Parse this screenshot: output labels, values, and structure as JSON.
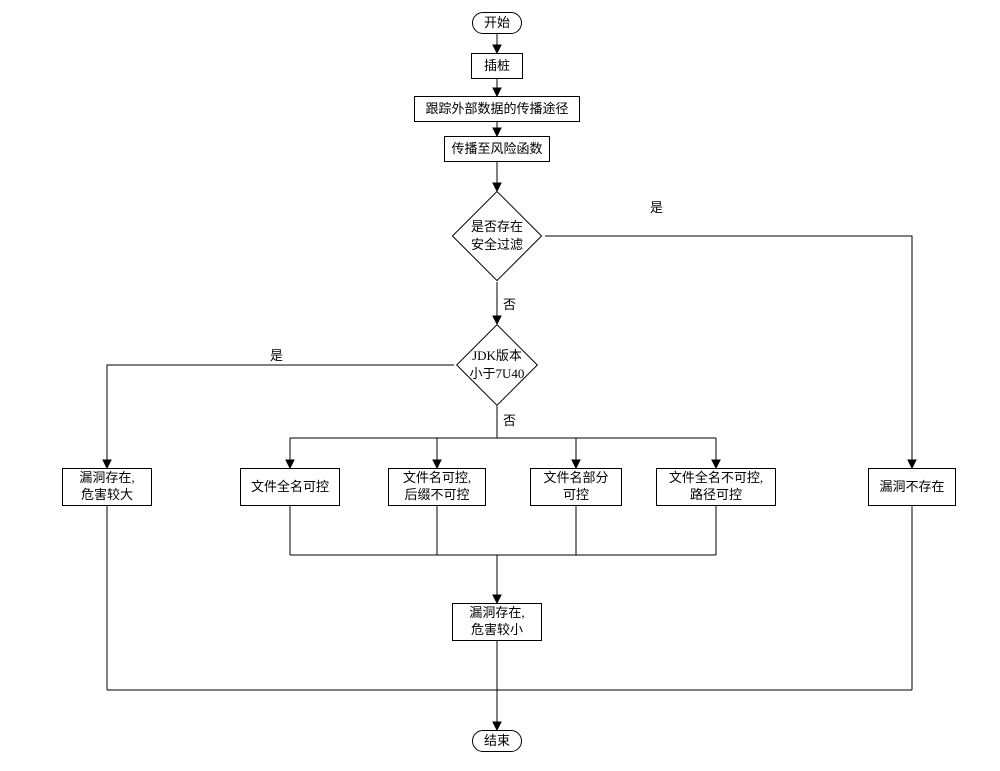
{
  "nodes": {
    "start": "开始",
    "instrument": "插桩",
    "track": "跟踪外部数据的传播途径",
    "propagate": "传播至风险函数",
    "decision_filter": "是否存在\n安全过滤",
    "decision_jdk": "JDK版本\n小于7U40",
    "vuln_big": "漏洞存在,\n危害较大",
    "name_full_ctl": "文件全名可控",
    "name_ctl_suffix_not": "文件名可控,\n后缀不可控",
    "name_partial_ctl": "文件名部分\n可控",
    "name_not_ctl_path_ctl": "文件全名不可控,\n路径可控",
    "vuln_none": "漏洞不存在",
    "vuln_small": "漏洞存在,\n危害较小",
    "end": "结束"
  },
  "edge_labels": {
    "yes1": "是",
    "no1": "否",
    "yes2": "是",
    "no2": "否"
  }
}
